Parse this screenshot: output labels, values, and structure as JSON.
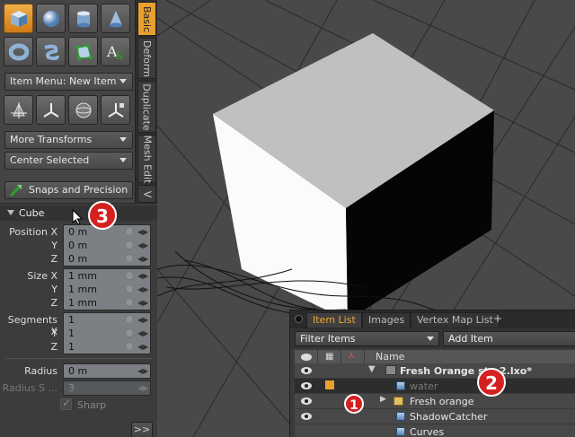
{
  "toolbox": {
    "item_menu_label": "Item Menu: New Item",
    "more_transforms_label": "More Transforms",
    "center_selected_label": "Center Selected",
    "snaps_label": "Snaps and Precision"
  },
  "side_tabs": [
    "Basic",
    "Deform",
    "Duplicate",
    "Mesh Edit",
    "V"
  ],
  "properties": {
    "section_title": "Cube",
    "position": {
      "label": "Position X",
      "y_label": "Y",
      "z_label": "Z",
      "values": [
        "0 m",
        "0 m",
        "0 m"
      ]
    },
    "size": {
      "label": "Size X",
      "y_label": "Y",
      "z_label": "Z",
      "values": [
        "1 mm",
        "1 mm",
        "1 mm"
      ]
    },
    "segments": {
      "label": "Segments X",
      "y_label": "Y",
      "z_label": "Z",
      "values": [
        "1",
        "1",
        "1"
      ]
    },
    "radius": {
      "label": "Radius",
      "value": "0 m"
    },
    "radius_segments": {
      "label": "Radius S ...",
      "value": "3"
    },
    "sharp_label": "Sharp",
    "more_button": ">>"
  },
  "item_list": {
    "tabs": [
      "Item List",
      "Images",
      "Vertex Map List",
      "+"
    ],
    "filter_label": "Filter Items",
    "add_item_label": "Add Item",
    "name_header": "Name",
    "rows": [
      {
        "name": "Fresh Orange st"
      },
      {
        "name": "2.lxo*"
      },
      {
        "name": "water"
      },
      {
        "name": "Fresh orange"
      },
      {
        "name": "ShadowCatcher"
      },
      {
        "name": "Curves"
      }
    ]
  },
  "badges": [
    "1",
    "2",
    "3"
  ],
  "colors": {
    "accent": "#e8a030",
    "badge": "#d42020"
  }
}
